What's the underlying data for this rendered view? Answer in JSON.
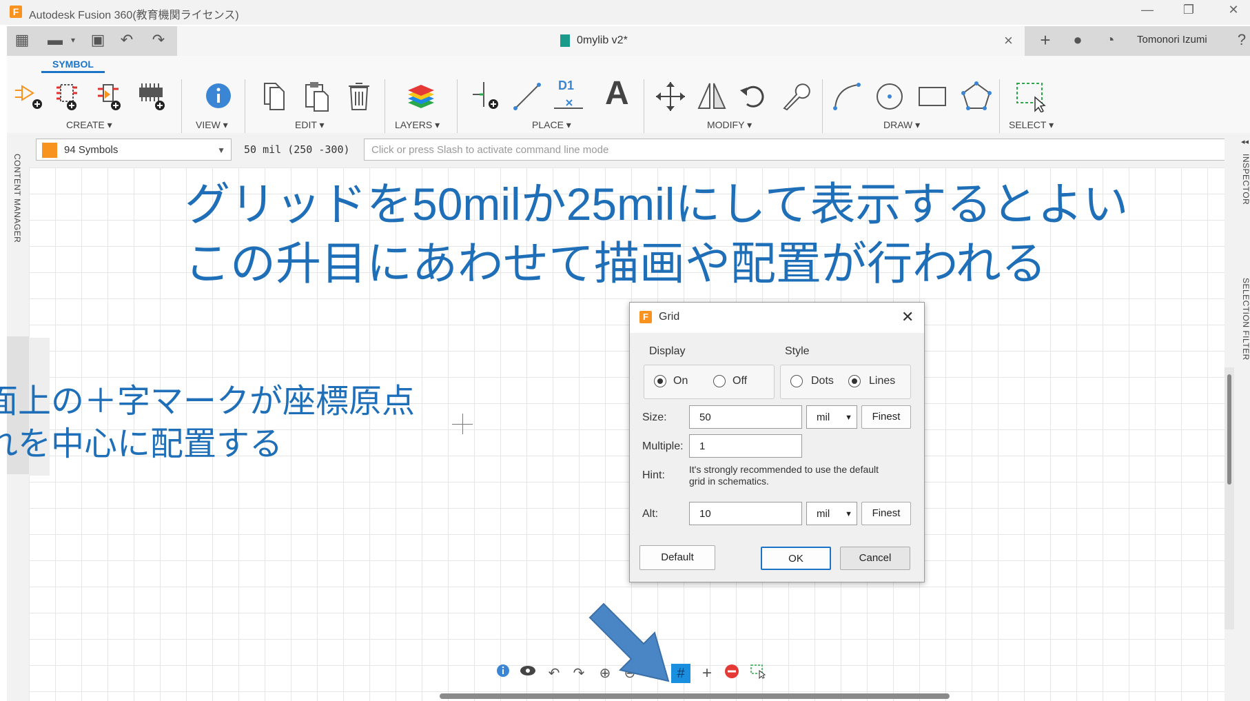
{
  "titlebar": {
    "title": "Autodesk Fusion 360(教育機関ライセンス)",
    "app_icon": "F"
  },
  "tab": {
    "name": "0mylib v2*"
  },
  "user": {
    "name": "Tomonori Izumi"
  },
  "ribbon": {
    "active_tab": "SYMBOL",
    "groups": {
      "create": "CREATE ▾",
      "view": "VIEW ▾",
      "edit": "EDIT ▾",
      "layers": "LAYERS ▾",
      "place": "PLACE ▾",
      "modify": "MODIFY ▾",
      "draw": "DRAW ▾",
      "select": "SELECT ▾"
    },
    "place_name_glyph": "D1",
    "text_glyph": "A"
  },
  "command_bar": {
    "layer": "94 Symbols",
    "layer_color": "#f7931e",
    "coords": "50 mil (250 -300)",
    "command_placeholder": "Click or press Slash to activate command line mode"
  },
  "side_panels": {
    "left": "CONTENT MANAGER",
    "right_top": "INSPECTOR",
    "right_bottom": "SELECTION FILTER"
  },
  "annotations": {
    "line1": "グリッドを50milか25milにして表示するとよい",
    "line2": "この升目にあわせて描画や配置が行われる",
    "line3": "面上の＋字マークが座標原点",
    "line4": "れを中心に配置する"
  },
  "grid_dialog": {
    "title": "Grid",
    "display_label": "Display",
    "style_label": "Style",
    "display_on": "On",
    "display_off": "Off",
    "style_dots": "Dots",
    "style_lines": "Lines",
    "display_selected": "On",
    "style_selected": "Lines",
    "size_label": "Size:",
    "size_value": "50",
    "size_unit": "mil",
    "finest": "Finest",
    "multiple_label": "Multiple:",
    "multiple_value": "1",
    "hint_label": "Hint:",
    "hint_text": "It's strongly recommended to use the default grid in schematics.",
    "alt_label": "Alt:",
    "alt_value": "10",
    "alt_unit": "mil",
    "default_btn": "Default",
    "ok_btn": "OK",
    "cancel_btn": "Cancel"
  },
  "colors": {
    "accent": "#1a73c7",
    "annotation": "#1f6fb8",
    "arrow": "#4a86c5",
    "grid_active": "#1a8fe0"
  }
}
